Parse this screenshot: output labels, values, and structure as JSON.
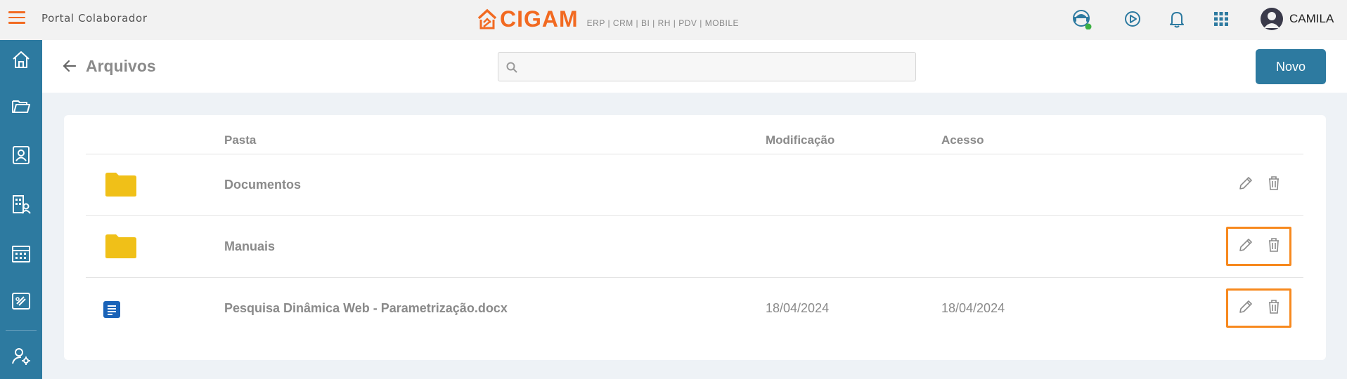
{
  "topbar": {
    "portal_title": "Portal Colaborador",
    "brand": "CIGAM",
    "brand_sub": "ERP | CRM | BI | RH | PDV | MOBILE",
    "user_name": "CAMILA",
    "accent": "#f26a21",
    "icons": [
      "support-agent-icon",
      "play-video-icon",
      "notification-bell-icon",
      "apps-grid-icon",
      "user-avatar-icon"
    ]
  },
  "sidebar": {
    "bg": "#2d7aa0",
    "items": [
      "home-icon",
      "folder-open-icon",
      "contacts-icon",
      "organization-icon",
      "calendar-icon",
      "ticket-icon",
      "user-settings-icon"
    ]
  },
  "page": {
    "title": "Arquivos",
    "search_placeholder": "",
    "new_button": "Novo"
  },
  "table": {
    "columns": {
      "pasta": "Pasta",
      "modificacao": "Modificação",
      "acesso": "Acesso"
    },
    "rows": [
      {
        "type": "folder",
        "name": "Documentos",
        "modified": "",
        "accessed": ""
      },
      {
        "type": "folder",
        "name": "Manuais",
        "modified": "",
        "accessed": ""
      },
      {
        "type": "document",
        "name": "Pesquisa Dinâmica Web - Parametrização.docx",
        "modified": "18/04/2024",
        "accessed": "18/04/2024"
      }
    ]
  },
  "colors": {
    "highlight": "#f7891e",
    "folder": "#f0c018",
    "doc": "#1a63b8",
    "primary": "#2d7aa0"
  }
}
